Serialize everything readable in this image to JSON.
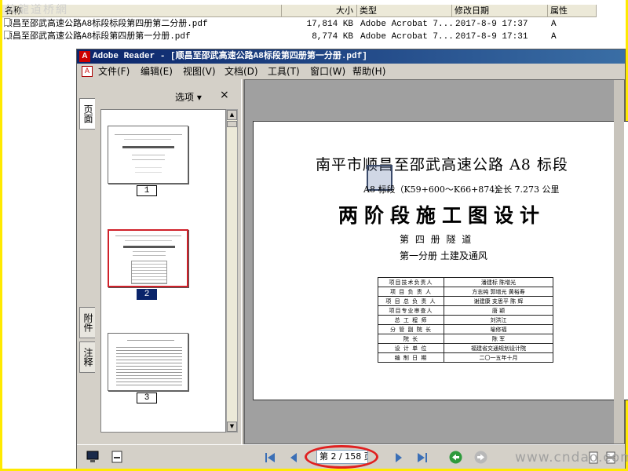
{
  "explorer": {
    "watermark": "筑龍道桥網",
    "columns": {
      "name": "名称",
      "size": "大小",
      "type": "类型",
      "modified": "修改日期",
      "attr": "属性"
    },
    "files": [
      {
        "name": "顺昌至邵武高速公路A8标段标段第四册第二分册.pdf",
        "size": "17,814 KB",
        "type": "Adobe Acrobat 7...",
        "modified": "2017-8-9 17:37",
        "attr": "A"
      },
      {
        "name": "顺昌至邵武高速公路A8标段第四册第一分册.pdf",
        "size": "8,774 KB",
        "type": "Adobe Acrobat 7...",
        "modified": "2017-8-9 17:31",
        "attr": "A"
      }
    ]
  },
  "reader": {
    "title": "Adobe Reader - [顺昌至邵武高速公路A8标段第四册第一分册.pdf]",
    "menu": [
      "文件(F)",
      "编辑(E)",
      "视图(V)",
      "文档(D)",
      "工具(T)",
      "窗口(W)",
      "帮助(H)"
    ],
    "nav_tabs": [
      "页面",
      "附件",
      "注释"
    ],
    "options_label": "选项 ▾",
    "close_label": "×",
    "thumbnails": [
      {
        "label": "1",
        "selected": false
      },
      {
        "label": "2",
        "selected": true
      },
      {
        "label": "3",
        "selected": false
      }
    ],
    "page_field": "第 2 / 158 页",
    "watermark": "www.cndao.com"
  },
  "document": {
    "title": "南平市顺昌至邵武高速公路 A8 标段",
    "section": "A8 标段（K59+600～K66+874）",
    "length": "全长 7.273 公里",
    "heading": "两阶段施工图设计",
    "volume": "第 四 册    隧    道",
    "subvolume": "第一分册    土建及通风",
    "signatures": [
      {
        "role": "项目技术负责人",
        "name": "潘建标  陈增光"
      },
      {
        "role": "项 目 负 责 人",
        "name": "方志纯  郭增光  黄裕寿"
      },
      {
        "role": "项 目 总 负 责 人",
        "name": "谢建康  支思平  陈  辉"
      },
      {
        "role": "项目专业审查人",
        "name": "唐  颖"
      },
      {
        "role": "总  工  程  师",
        "name": "刘洪江"
      },
      {
        "role": "分 管 副 院 长",
        "name": "喻修福"
      },
      {
        "role": "院        长",
        "name": "陈  军"
      },
      {
        "role": "设  计  单  位",
        "name": "福建省交通规划设计院"
      },
      {
        "role": "编  制  日  期",
        "name": "二〇一五年十月"
      }
    ]
  }
}
